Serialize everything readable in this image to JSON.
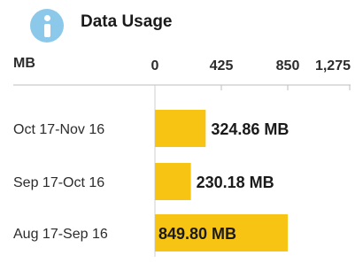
{
  "header": {
    "title": "Data Usage",
    "icon": "info-icon",
    "icon_color": "#8cc8ea"
  },
  "chart_data": {
    "type": "bar",
    "orientation": "horizontal",
    "unit_label": "MB",
    "xlim": [
      0,
      1275
    ],
    "x_ticks": [
      0,
      425,
      850,
      1275
    ],
    "x_tick_labels": [
      "0",
      "425",
      "850",
      "1,275"
    ],
    "axis_position": "top",
    "grid": false,
    "bar_color": "#f7c413",
    "categories": [
      "Oct 17-Nov 16",
      "Sep 17-Oct 16",
      "Aug 17-Sep 16"
    ],
    "values": [
      324.86,
      230.18,
      849.8
    ],
    "value_labels": [
      "324.86 MB",
      "230.18 MB",
      "849.80 MB"
    ]
  }
}
